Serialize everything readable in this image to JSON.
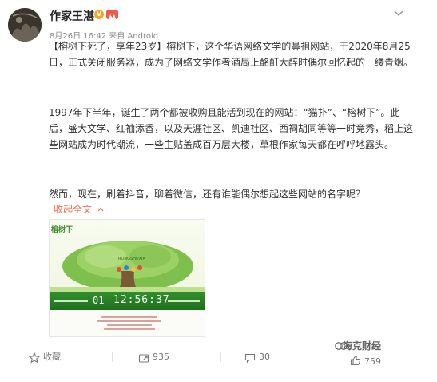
{
  "author": {
    "name": "作家王湛",
    "verified_badge": "V",
    "colors": {
      "verified": "#f6a623",
      "level": "#f05a4a"
    }
  },
  "meta": {
    "text": "8月26日 16:42 来自 Android"
  },
  "post": {
    "paragraph_1": "【榕树下死了，享年23岁】榕树下，这个华语网络文学的鼻祖网站，于2020年8月25日，正式关闭服务器，成为了网络文学作者酒局上酩酊大醉时偶尔回忆起的一缕青烟。",
    "paragraph_2": "1997年下半年，诞生了两个都被收购且能活到现在的网站：“猫扑”、“榕树下”。此后，盛大文学、红袖添香，以及天涯社区、凯迪社区、西祠胡同等等一时竞秀，稻上这些网站成为时代潮流，一些主贴盖成百万层大楼，草根作家每天都在呼呼地露头。",
    "paragraph_3": "然而，现在，刷着抖音，聊着微信，还有谁能偶尔想起这些网站的名字呢？",
    "expand_label": "收起全文",
    "link_color": "#eb7350"
  },
  "image": {
    "logo_text": "榕树下",
    "site_text": "RONGSHUXIA",
    "days": "01",
    "clock": "12:56:37"
  },
  "actions": {
    "favorite": {
      "label": "收藏",
      "icon": "star-icon"
    },
    "repost": {
      "count": "935",
      "icon": "repost-icon"
    },
    "comment": {
      "count": "30",
      "icon": "comment-icon"
    },
    "like": {
      "count": "759",
      "icon": "thumbs-up-icon"
    }
  },
  "watermark": {
    "text": "海克财经"
  }
}
